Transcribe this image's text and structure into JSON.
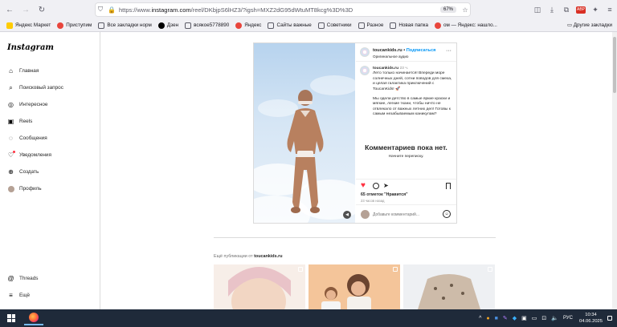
{
  "browser": {
    "url_prefix": "https://www.",
    "url_host": "instagram.com",
    "url_path": "/reel/DKbjpS6lHZ3/?igsh=MXZ2dG95dWtuMT8kcg%3D%3D",
    "zoom": "67%"
  },
  "bookmarks": [
    {
      "label": "Яндекс Маркет",
      "color": "#fc0"
    },
    {
      "label": "Приступим",
      "color": "#e8453c"
    },
    {
      "label": "Все закладки норм",
      "color": "#5b5b66"
    },
    {
      "label": "Дзен",
      "color": "#000"
    },
    {
      "label": "всякое5778890",
      "color": "#5b5b66"
    },
    {
      "label": "Яндекс",
      "color": "#e8453c"
    },
    {
      "label": "Сайты важные",
      "color": "#5b5b66"
    },
    {
      "label": "Советники",
      "color": "#5b5b66"
    },
    {
      "label": "Разное",
      "color": "#5b5b66"
    },
    {
      "label": "Новая папка",
      "color": "#5b5b66"
    },
    {
      "label": "ом — Яндекс: нашло...",
      "color": "#e8453c"
    }
  ],
  "bookmarks_other": "Другие закладки",
  "sidebar": {
    "logo": "Instagram",
    "items": [
      {
        "label": "Главная"
      },
      {
        "label": "Поисковый запрос"
      },
      {
        "label": "Интересное"
      },
      {
        "label": "Reels"
      },
      {
        "label": "Сообщения"
      },
      {
        "label": "Уведомления"
      },
      {
        "label": "Создать"
      },
      {
        "label": "Профиль"
      }
    ],
    "bottom_items": [
      {
        "label": "Threads"
      },
      {
        "label": "Ещё"
      }
    ]
  },
  "post": {
    "username": "toucankids.ru",
    "follow": "Подписаться",
    "audio": "Оригинальное аудио",
    "caption_user": "toucankids.ru",
    "caption_time": "23 ч.",
    "caption_p1": "Лето только начинается! Впереди море солнечных дней, сотни поводов для смеха, и целая галактика приключений с ToucanKids! 🚀",
    "caption_p2": "Мы одели детство в самые яркие краски и мягкие, легкие ткани, чтобы ничто не отвлекало от важных летних дел! Готовы к самым незабываемым каникулам?",
    "no_comments": "Комментариев пока нет.",
    "start_chat": "Начните переписку.",
    "likes": "65 отметок \"Нравится\"",
    "ago": "23 часов назад",
    "comment_placeholder": "Добавьте комментарий..."
  },
  "more_posts": {
    "prefix": "Ещё публикации от",
    "user": "toucankids.ru"
  },
  "taskbar": {
    "lang": "РУС",
    "time": "10:34",
    "date": "04.06.2025"
  }
}
